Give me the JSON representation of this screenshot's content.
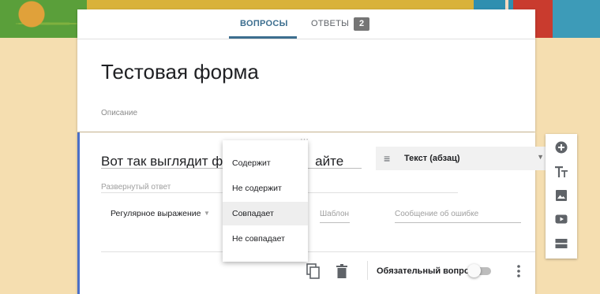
{
  "tabs": {
    "questions": "ВОПРОСЫ",
    "answers": "ОТВЕТЫ",
    "answers_count": "2"
  },
  "form": {
    "title": "Тестовая форма",
    "description_placeholder": "Описание"
  },
  "question": {
    "title_visible": "Вот так выглядит фор",
    "title_visible_end": "айте",
    "type": "Текст (абзац)",
    "answer_hint": "Развернутый ответ",
    "validation_type": "Регулярное выражение",
    "pattern_placeholder": "Шаблон",
    "error_placeholder": "Сообщение об ошибке",
    "required_label": "Обязательный вопрос",
    "required": false
  },
  "dropdown": {
    "options": [
      "Содержит",
      "Не содержит",
      "Совпадает",
      "Не совпадает"
    ],
    "selected": "Совпадает"
  },
  "toolbar_icons": [
    "add-question-icon",
    "add-title-icon",
    "add-image-icon",
    "add-video-icon",
    "add-section-icon"
  ],
  "colors": {
    "accent": "#3c6e8f",
    "question_accent": "#4a6fc7",
    "background": "#f5deb0"
  }
}
